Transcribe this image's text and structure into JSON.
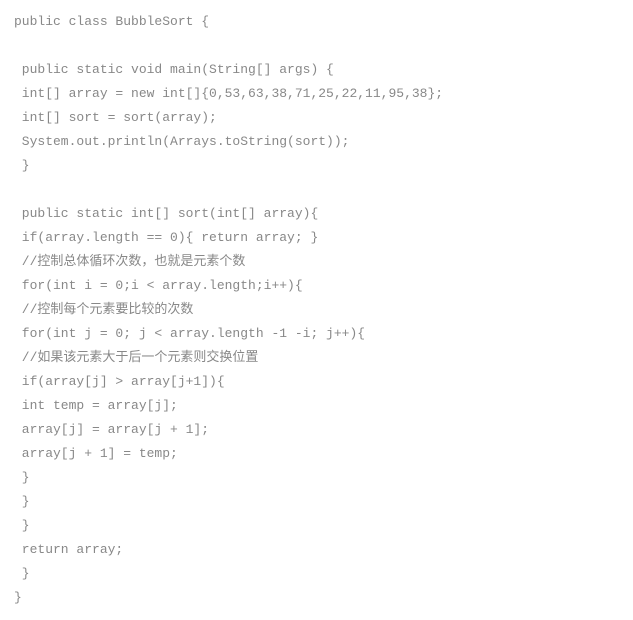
{
  "code": {
    "lines": [
      "public class BubbleSort {",
      "",
      " public static void main(String[] args) {",
      " int[] array = new int[]{0,53,63,38,71,25,22,11,95,38};",
      " int[] sort = sort(array);",
      " System.out.println(Arrays.toString(sort));",
      " }",
      "",
      " public static int[] sort(int[] array){",
      " if(array.length == 0){ return array; }",
      " //控制总体循环次数，也就是元素个数",
      " for(int i = 0;i < array.length;i++){",
      " //控制每个元素要比较的次数",
      " for(int j = 0; j < array.length -1 -i; j++){",
      " //如果该元素大于后一个元素则交换位置",
      " if(array[j] > array[j+1]){",
      " int temp = array[j];",
      " array[j] = array[j + 1];",
      " array[j + 1] = temp;",
      " }",
      " }",
      " }",
      " return array;",
      " }",
      "}"
    ]
  }
}
